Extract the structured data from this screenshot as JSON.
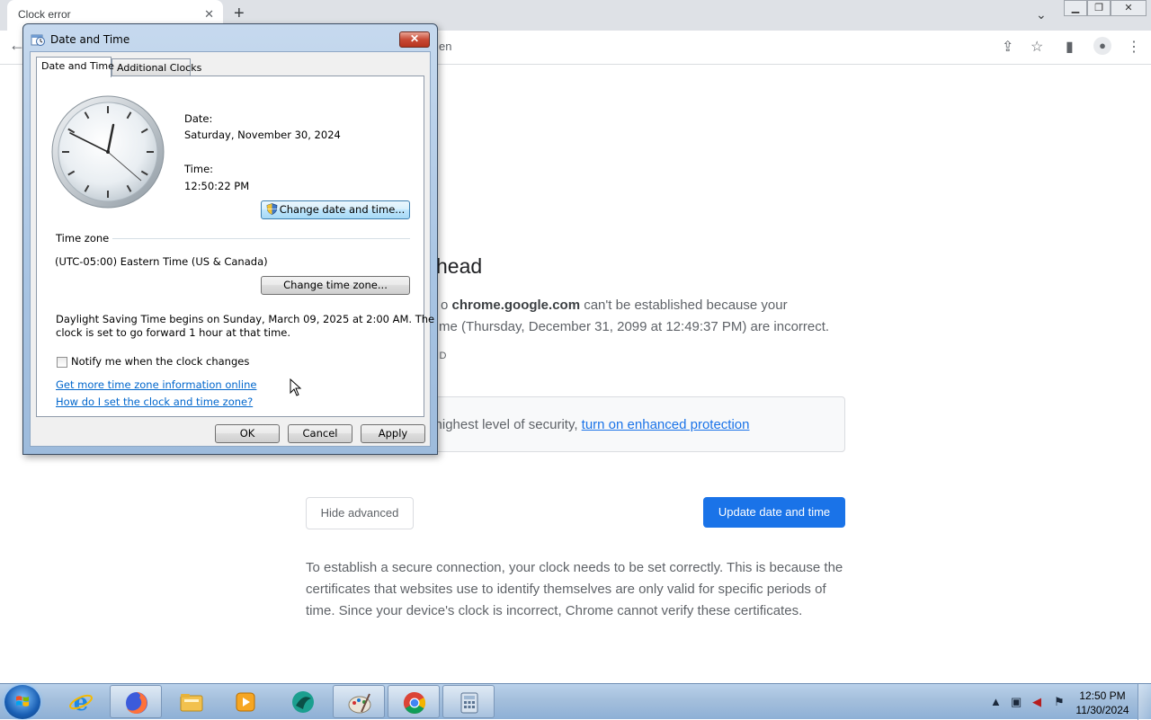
{
  "browser": {
    "tab_title": "Clock error",
    "tab_close": "✕",
    "new_tab": "+",
    "omnibox_fragment": "en"
  },
  "page": {
    "heading_visible": "head",
    "para1_prefix": "o ",
    "para1_domain": "chrome.google.com",
    "para1_rest1": " can't be established because your",
    "para1_line2": "me (Thursday, December 31, 2099 at 12:49:37 PM) are incorrect.",
    "error_code_fragment": "ID",
    "enhanced_text": "'s highest level of security, ",
    "enhanced_link": "turn on enhanced protection",
    "hide_advanced": "Hide advanced",
    "update_button": "Update date and time",
    "para2": "To establish a secure connection, your clock needs to be set correctly. This is because the certificates that websites use to identify themselves are only valid for specific periods of time. Since your device's clock is incorrect, Chrome cannot verify these certificates."
  },
  "dialog": {
    "title": "Date and Time",
    "close": "✕",
    "tabs": [
      "Date and Time",
      "Additional Clocks"
    ],
    "date_label": "Date:",
    "date_value": "Saturday, November 30, 2024",
    "time_label": "Time:",
    "time_value": "12:50:22 PM",
    "change_datetime_btn": "Change date and time...",
    "timezone_header": "Time zone",
    "timezone_value": "(UTC-05:00) Eastern Time (US & Canada)",
    "change_timezone_btn": "Change time zone...",
    "dst_line1": "Daylight Saving Time begins on Sunday, March 09, 2025 at 2:00 AM. The",
    "dst_line2": "clock is set to go forward 1 hour at that time.",
    "notify_label": "Notify me when the clock changes",
    "notify_checked": false,
    "link1": "Get more time zone information online",
    "link2": "How do I set the clock and time zone?",
    "ok": "OK",
    "cancel": "Cancel",
    "apply": "Apply"
  },
  "taskbar": {
    "pinned": [
      "internet-explorer-icon",
      "firefox-icon",
      "file-explorer-icon",
      "media-player-icon",
      "app-icon",
      "paint-icon",
      "chrome-icon",
      "calculator-icon"
    ],
    "clock_time": "12:50 PM",
    "clock_date": "11/30/2024"
  }
}
